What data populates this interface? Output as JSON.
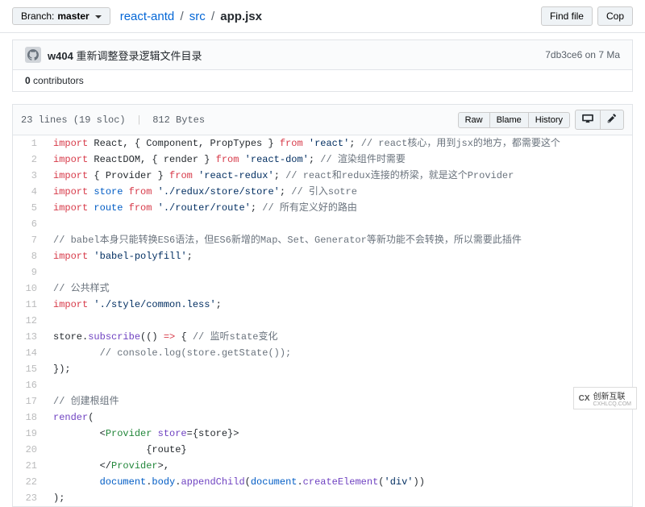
{
  "topbar": {
    "branch_prefix": "Branch:",
    "branch_name": "master",
    "crumb_root": "react-antd",
    "crumb_mid": "src",
    "crumb_file": "app.jsx",
    "find_file": "Find file",
    "copy": "Cop"
  },
  "commit": {
    "user": "w404",
    "message": "重新调整登录逻辑文件目录",
    "sha": "7db3ce6",
    "on": "on",
    "date": "7 Ma"
  },
  "contributors": {
    "count": "0",
    "label": "contributors"
  },
  "filemeta": {
    "lines": "23 lines (19 sloc)",
    "bytes": "812 Bytes"
  },
  "actions": {
    "raw": "Raw",
    "blame": "Blame",
    "history": "History"
  },
  "watermark": {
    "brand": "创新互联",
    "sub": "CXHLCQ.COM"
  },
  "code": [
    {
      "n": 1,
      "html": "<span class='k'>import</span> React, { Component, PropTypes } <span class='k'>from</span> <span class='s'>'react'</span>; <span class='c'>// react核心，用到jsx的地方，都需要这个</span>"
    },
    {
      "n": 2,
      "html": "<span class='k'>import</span> ReactDOM, { render } <span class='k'>from</span> <span class='s'>'react-dom'</span>; <span class='c'>// 渲染组件时需要</span>"
    },
    {
      "n": 3,
      "html": "<span class='k'>import</span> { Provider } <span class='k'>from</span> <span class='s'>'react-redux'</span>; <span class='c'>// react和redux连接的桥梁，就是这个Provider</span>"
    },
    {
      "n": 4,
      "html": "<span class='k'>import</span> <span class='v'>store</span> <span class='k'>from</span> <span class='s'>'./redux/store/store'</span>; <span class='c'>// 引入sotre</span>"
    },
    {
      "n": 5,
      "html": "<span class='k'>import</span> <span class='v'>route</span> <span class='k'>from</span> <span class='s'>'./router/route'</span>; <span class='c'>// 所有定义好的路由</span>"
    },
    {
      "n": 6,
      "html": ""
    },
    {
      "n": 7,
      "html": "<span class='c'>// babel本身只能转换ES6语法，但ES6新增的Map、Set、Generator等新功能不会转换，所以需要此插件</span>"
    },
    {
      "n": 8,
      "html": "<span class='k'>import</span> <span class='s'>'babel-polyfill'</span>;"
    },
    {
      "n": 9,
      "html": ""
    },
    {
      "n": 10,
      "html": "<span class='c'>// 公共样式</span>"
    },
    {
      "n": 11,
      "html": "<span class='k'>import</span> <span class='s'>'./style/common.less'</span>;"
    },
    {
      "n": 12,
      "html": ""
    },
    {
      "n": 13,
      "html": "store.<span class='f'>subscribe</span>(() <span class='k'>=&gt;</span> { <span class='c'>// 监听state变化</span>"
    },
    {
      "n": 14,
      "html": "        <span class='c'>// console.log(store.getState());</span>"
    },
    {
      "n": 15,
      "html": "});"
    },
    {
      "n": 16,
      "html": ""
    },
    {
      "n": 17,
      "html": "<span class='c'>// 创建根组件</span>"
    },
    {
      "n": 18,
      "html": "<span class='f'>render</span>("
    },
    {
      "n": 19,
      "html": "        &lt;<span class='e'>Provider</span> <span class='f'>store</span>={store}&gt;"
    },
    {
      "n": 20,
      "html": "                {route}"
    },
    {
      "n": 21,
      "html": "        &lt;/<span class='e'>Provider</span>&gt;,"
    },
    {
      "n": 22,
      "html": "        <span class='v'>document</span>.<span class='v'>body</span>.<span class='f'>appendChild</span>(<span class='v'>document</span>.<span class='f'>createElement</span>(<span class='s'>'div'</span>))"
    },
    {
      "n": 23,
      "html": ");"
    }
  ]
}
